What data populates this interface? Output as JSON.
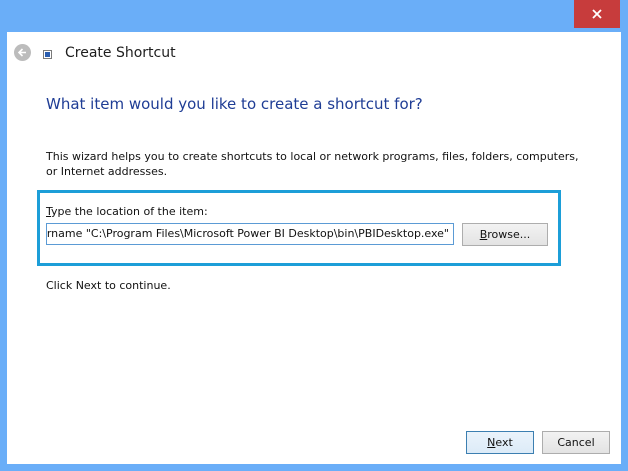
{
  "titlebar": {
    "close_icon": "close-icon"
  },
  "header": {
    "back_icon": "back-arrow-icon",
    "shortcut_icon": "shortcut-icon",
    "title": "Create Shortcut"
  },
  "main": {
    "heading": "What item would you like to create a shortcut for?",
    "description": "This wizard helps you to create shortcuts to local or network programs, files, folders, computers, or Internet addresses.",
    "location_label_prefix": "T",
    "location_label_rest": "ype the location of the item:",
    "location_value": "\"C:\\Program Files\\Microsoft Power BI Desktop\\bin\\PBIDesktop.exe\"",
    "location_value_visible": "ername \"C:\\Program Files\\Microsoft Power BI Desktop\\bin\\PBIDesktop.exe\"",
    "browse_prefix": "B",
    "browse_rest": "rowse...",
    "continue_text": "Click Next to continue."
  },
  "footer": {
    "next_prefix": "N",
    "next_rest": "ext",
    "cancel_label": "Cancel"
  },
  "colors": {
    "window_frame": "#6aaef8",
    "close_button": "#c73c3c",
    "heading": "#1f3d95",
    "highlight": "#1c9ed8"
  }
}
